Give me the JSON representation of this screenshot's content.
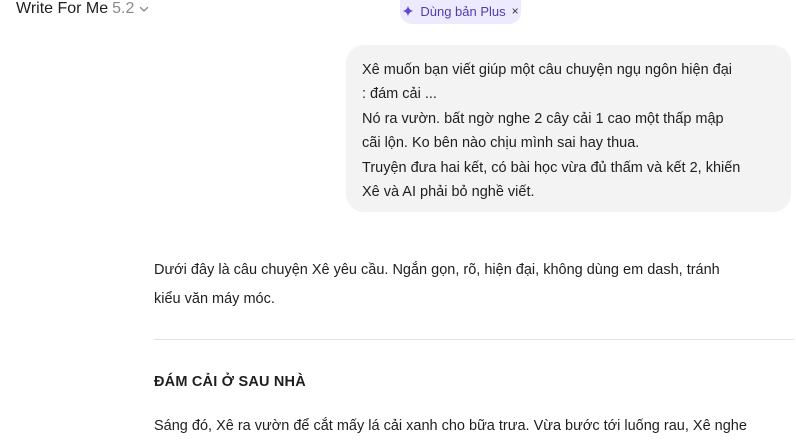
{
  "header": {
    "model_name": "Write For Me",
    "model_version": "5.2",
    "chevron_icon": "chevron-down-icon",
    "plus_label": "Dùng bản Plus",
    "plus_icon": "sparkle-icon",
    "close_label": "×",
    "accent_color": "#4b3fb0",
    "pill_bg": "#eeeafe"
  },
  "user_message": {
    "lines": [
      "Xê muốn bạn viết giúp một câu chuyện ngụ ngôn hiện đại",
      ": đám cải ...",
      "Nó ra vườn. bất ngờ nghe 2 cây cải 1 cao một thấp mập",
      "cãi lộn. Ko bên nào chịu mình sai hay thua.",
      "Truyện đưa hai kết, có bài học  vừa đủ thấm và kết 2, khiến",
      "Xê và AI phải bỏ nghề viết."
    ]
  },
  "assistant_message": {
    "intro_lines": [
      "Dưới đây là câu chuyện Xê yêu cầu. Ngắn gọn, rõ, hiện đại, không dùng em dash, tránh",
      "kiểu văn máy móc."
    ],
    "story_title": "ĐÁM CẢI Ở SAU NHÀ",
    "story_first_line": "Sáng đó, Xê ra vườn để cắt mấy lá cải xanh cho bữa trưa. Vừa bước tới luống rau, Xê nghe"
  }
}
